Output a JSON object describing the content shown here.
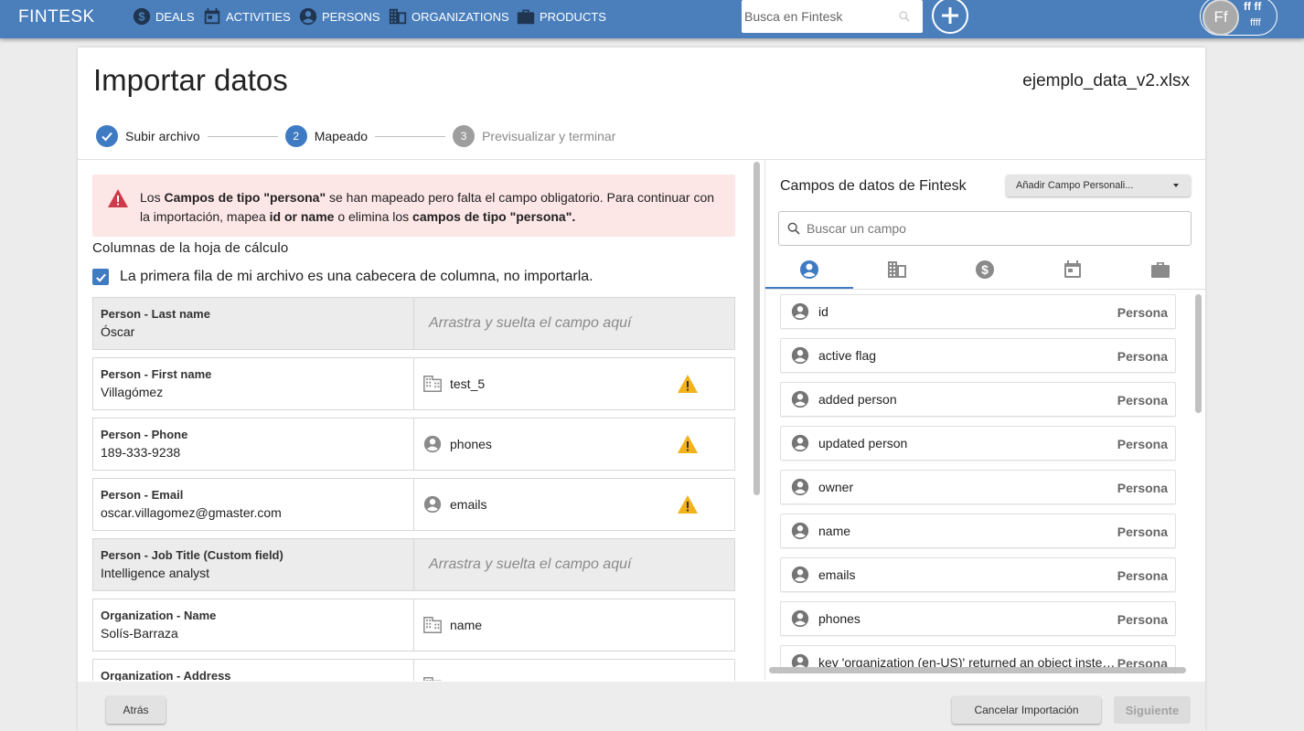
{
  "nav": {
    "brand": "FINTESK",
    "items": [
      {
        "label": "DEALS",
        "icon": "dollar-icon"
      },
      {
        "label": "ACTIVITIES",
        "icon": "calendar-icon"
      },
      {
        "label": "PERSONS",
        "icon": "person-icon"
      },
      {
        "label": "ORGANIZATIONS",
        "icon": "building-icon"
      },
      {
        "label": "PRODUCTS",
        "icon": "briefcase-icon"
      }
    ],
    "search_placeholder": "Busca en Fintesk",
    "user": {
      "initials": "Ff",
      "name": "ff ff",
      "sub": "ffff"
    }
  },
  "page": {
    "title": "Importar datos",
    "file_name": "ejemplo_data_v2.xlsx",
    "steps": [
      {
        "num": "",
        "label": "Subir archivo",
        "state": "done"
      },
      {
        "num": "2",
        "label": "Mapeado",
        "state": "active"
      },
      {
        "num": "3",
        "label": "Previsualizar y terminar",
        "state": "todo"
      }
    ]
  },
  "alert": {
    "t1": "Los ",
    "b1": "Campos de tipo \"persona\"",
    "t2": " se han mapeado pero falta el campo obligatorio. Para continuar con la importación, mapea ",
    "b2": "id or name",
    "t3": " o elimina los ",
    "b3": "campos de tipo \"persona\"."
  },
  "columns": {
    "title": "Columnas de la hoja de cálculo",
    "header_checkbox_label": "La primera fila de mi archivo es una cabecera de columna, no importarla.",
    "drop_placeholder": "Arrastra y suelta el campo aquí",
    "rows": [
      {
        "header": "Person - Last name",
        "value": "Óscar",
        "mapped": "",
        "icon": "",
        "warn": false
      },
      {
        "header": "Person - First name",
        "value": "Villagómez",
        "mapped": "test_5",
        "icon": "building-icon",
        "warn": true
      },
      {
        "header": "Person - Phone",
        "value": "189-333-9238",
        "mapped": "phones",
        "icon": "person-icon",
        "warn": true
      },
      {
        "header": "Person - Email",
        "value": "oscar.villagomez@gmaster.com",
        "mapped": "emails",
        "icon": "person-icon",
        "warn": true
      },
      {
        "header": "Person - Job Title (Custom field)",
        "value": "Intelligence analyst",
        "mapped": "",
        "icon": "",
        "warn": false
      },
      {
        "header": "Organization - Name",
        "value": "Solís-Barraza",
        "mapped": "name",
        "icon": "building-icon",
        "warn": false
      },
      {
        "header": "Organization - Address",
        "value": "",
        "mapped": "",
        "icon": "building-icon",
        "warn": false
      }
    ]
  },
  "fields_panel": {
    "title": "Campos de datos de Fintesk",
    "add_button": "Añadir Campo Personali...",
    "search_placeholder": "Buscar un campo",
    "tabs": [
      "person-icon",
      "building-icon",
      "dollar-icon",
      "calendar-icon",
      "briefcase-icon"
    ],
    "items": [
      {
        "name": "id",
        "type": "Persona"
      },
      {
        "name": "active flag",
        "type": "Persona"
      },
      {
        "name": "added person",
        "type": "Persona"
      },
      {
        "name": "updated person",
        "type": "Persona"
      },
      {
        "name": "owner",
        "type": "Persona"
      },
      {
        "name": "name",
        "type": "Persona"
      },
      {
        "name": "emails",
        "type": "Persona"
      },
      {
        "name": "phones",
        "type": "Persona"
      },
      {
        "name": "key 'organization (en-US)' returned an object instead of string.",
        "type": "Persona"
      }
    ]
  },
  "footer": {
    "back": "Atrás",
    "cancel": "Cancelar Importación",
    "next": "Siguiente"
  },
  "colors": {
    "primary": "#4a7fbc",
    "accent": "#3f7bc3",
    "alert_bg": "#fde6e6",
    "alert_icon": "#d0394a",
    "warning": "#f2b21a"
  }
}
